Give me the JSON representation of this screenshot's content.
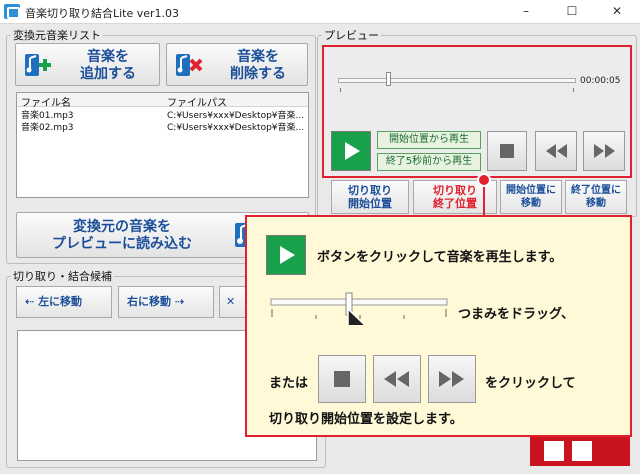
{
  "window": {
    "title": "音楽切り取り結合Lite ver1.03",
    "minimize_glyph": "–",
    "maximize_glyph": "☐",
    "close_glyph": "✕"
  },
  "source_group": {
    "legend": "変換元音楽リスト",
    "add_button": [
      "音楽を",
      "追加する"
    ],
    "remove_button": [
      "音楽を",
      "削除する"
    ],
    "columns": [
      "ファイル名",
      "ファイルパス"
    ],
    "rows": [
      [
        "音楽01.mp3",
        "C:¥Users¥xxx¥Desktop¥音楽..."
      ],
      [
        "音楽02.mp3",
        "C:¥Users¥xxx¥Desktop¥音楽..."
      ]
    ],
    "preview_load_button": [
      "変換元の音楽を",
      "プレビューに読み込む"
    ]
  },
  "preview_group": {
    "legend": "プレビュー",
    "position_fraction": 0.2,
    "timecode": "00:00:05",
    "play_from_start": "開始位置から再生",
    "play_5s_before_end": "終了5秒前から再生",
    "cut_start": [
      "切り取り",
      "開始位置"
    ],
    "cut_end": [
      "切り取り",
      "終了位置"
    ],
    "goto_start": [
      "開始位置に",
      "移動"
    ],
    "goto_end": [
      "終了位置に",
      "移動"
    ]
  },
  "candidates_group": {
    "legend": "切り取り・結合候補",
    "move_left": "左に移動",
    "move_right": "右に移動"
  },
  "callout": {
    "line1": "ボタンをクリックして音楽を再生します。",
    "line2": "つまみをドラッグ、",
    "line3_prefix": "または",
    "line3_suffix": "をクリックして",
    "line4": "切り取り開始位置を設定します。"
  },
  "colors": {
    "accent_red": "#e0212f",
    "play_green": "#18a04a",
    "label_blue": "#1c4f99",
    "callout_bg": "#fff9d8"
  }
}
